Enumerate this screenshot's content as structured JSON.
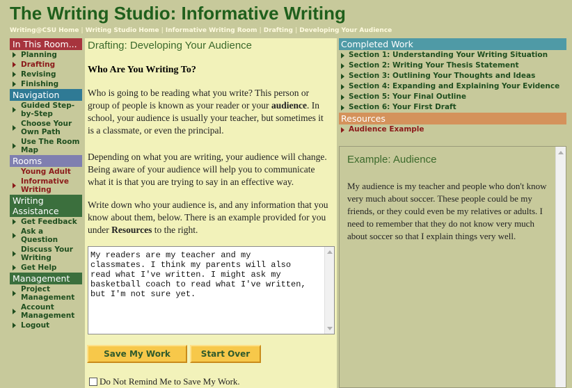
{
  "header": {
    "title": "The Writing Studio: Informative Writing",
    "breadcrumbs": [
      "Writing@CSU Home",
      "Writing Studio Home",
      "Informative Writing Room",
      "Drafting",
      "Developing Your Audience"
    ]
  },
  "leftnav": {
    "room_heading": "In This Room...",
    "room_items": [
      "Planning",
      "Drafting",
      "Revising",
      "Finishing"
    ],
    "navigation_heading": "Navigation",
    "navigation_items": [
      "Guided Step-by-Step",
      "Choose Your Own Path",
      "Use The Room Map"
    ],
    "rooms_heading": "Rooms",
    "rooms_items": [
      "Young Adult",
      "Informative Writing"
    ],
    "assist_heading": "Writing Assistance",
    "assist_items": [
      "Get Feedback",
      "Ask a Question",
      "Discuss Your Writing",
      "Get Help"
    ],
    "mgmt_heading": "Management",
    "mgmt_items": [
      "Project Management",
      "Account Management",
      "Logout"
    ]
  },
  "content": {
    "title": "Drafting: Developing Your Audience",
    "subheading": "Who Are You Writing To?",
    "p1_before": "Who is going to be reading what you write? This person or group of people is known as your reader or your ",
    "p1_bold": "audience",
    "p1_after": ". In school, your audience is usually your teacher, but sometimes it is a classmate, or even the principal.",
    "p2": "Depending on what you are writing, your audience will change. Being aware of your audience will help you to communicate what it is that you are trying to say in an effective way.",
    "p3_before": "Write down who your audience is, and any information that you know about them, below. There is an example provided for you under ",
    "p3_bold": "Resources",
    "p3_after": " to the right.",
    "answer": "My readers are my teacher and my\nclassmates. I think my parents will also\nread what I've written. I might ask my\nbasketball coach to read what I've written,\nbut I'm not sure yet.",
    "save_label": "Save My Work",
    "start_over_label": "Start Over",
    "remind_label": "Do Not Remind Me to Save My Work."
  },
  "rightcol": {
    "completed_heading": "Completed Work",
    "completed_items": [
      "Section 1: Understanding Your Writing Situation",
      "Section 2: Writing Your Thesis Statement",
      "Section 3: Outlining Your Thoughts and Ideas",
      "Section 4: Expanding and Explaining Your Evidence",
      "Section 5: Your Final Outline",
      "Section 6: Your First Draft"
    ],
    "resources_heading": "Resources",
    "resources_items": [
      "Audience Example"
    ],
    "example_title": "Example: Audience",
    "example_text": "My audience is my teacher and people who don't know very much about soccer. These people could be my friends, or they could even be my relatives or adults. I need to remember that they do not know very much about soccer so that I explain things very well."
  },
  "colors": {
    "title_green": "#1f5f1c",
    "page_bg": "#c7c99b",
    "content_bg": "#f2f2ba",
    "button_yellow": "#f7c84a",
    "active_red": "#8b1a1a"
  }
}
